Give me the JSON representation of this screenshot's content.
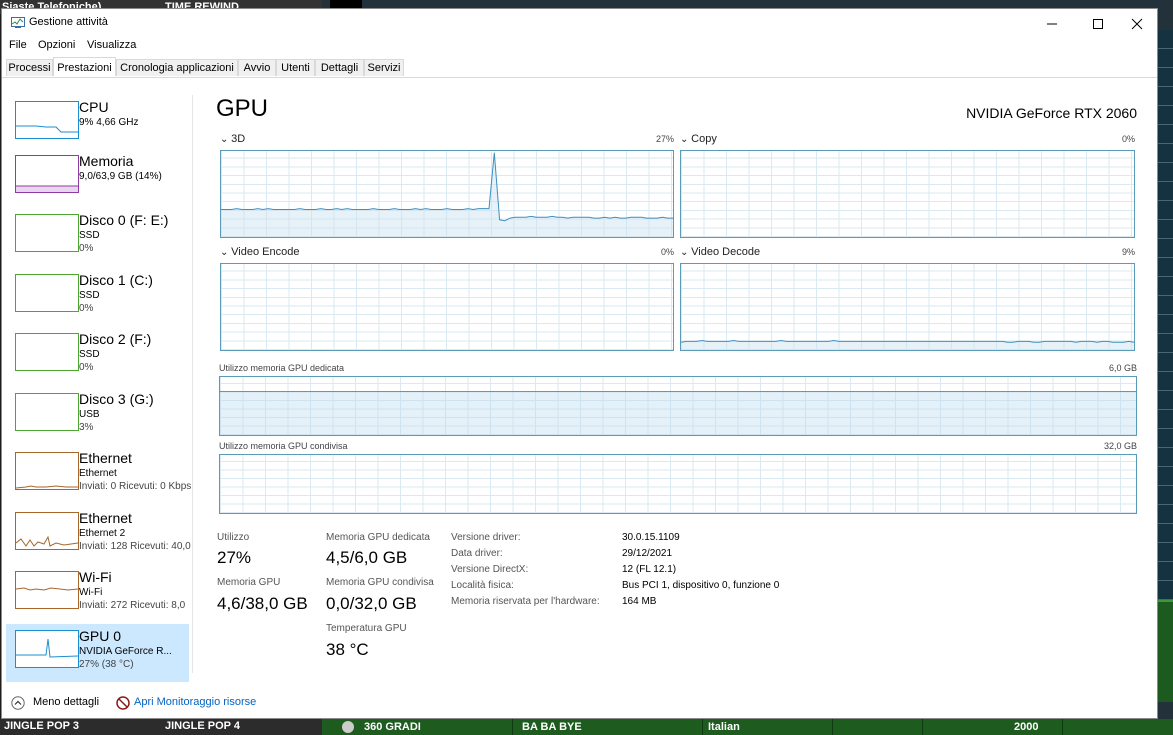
{
  "background": {
    "left_top_text": "Siaste Telefoniche)",
    "left_top_text2": "TIME REWIND",
    "left_bottom_text1": "JINGLE POP 3",
    "left_bottom_text2": "JINGLE POP 4",
    "bottom_row": {
      "title": "360 GRADI",
      "artist": "BA BA BYE",
      "lang": "Italian",
      "year": "2000"
    }
  },
  "window": {
    "title": "Gestione attività",
    "menu": [
      "File",
      "Opzioni",
      "Visualizza"
    ],
    "tabs": [
      "Processi",
      "Prestazioni",
      "Cronologia applicazioni",
      "Avvio",
      "Utenti",
      "Dettagli",
      "Servizi"
    ],
    "active_tab": "Prestazioni"
  },
  "sidebar": {
    "items": [
      {
        "name": "CPU",
        "line2": "9%  4,66 GHz",
        "line3": "",
        "color": "#1a8fcf"
      },
      {
        "name": "Memoria",
        "line2": "9,0/63,9 GB (14%)",
        "line3": "",
        "color": "#8e3ca3"
      },
      {
        "name": "Disco 0 (F: E:)",
        "line2": "SSD",
        "line3": "0%",
        "color": "#4da630"
      },
      {
        "name": "Disco 1 (C:)",
        "line2": "SSD",
        "line3": "0%",
        "color": "#4da630"
      },
      {
        "name": "Disco 2 (F:)",
        "line2": "SSD",
        "line3": "0%",
        "color": "#4da630"
      },
      {
        "name": "Disco 3 (G:)",
        "line2": "USB",
        "line3": "3%",
        "color": "#4da630"
      },
      {
        "name": "Ethernet",
        "line2": "Ethernet",
        "line3": "Inviati: 0 Ricevuti: 0 Kbps",
        "color": "#a7662a"
      },
      {
        "name": "Ethernet",
        "line2": "Ethernet 2",
        "line3": "Inviati: 128 Ricevuti: 40,0",
        "color": "#a7662a"
      },
      {
        "name": "Wi-Fi",
        "line2": "Wi-Fi",
        "line3": "Inviati: 272 Ricevuti: 8,0",
        "color": "#a7662a"
      },
      {
        "name": "GPU 0",
        "line2": "NVIDIA GeForce R...",
        "line3": "27%  (38 °C)",
        "color": "#1a8fcf"
      }
    ]
  },
  "main": {
    "title": "GPU",
    "model": "NVIDIA GeForce RTX 2060",
    "engines": [
      {
        "label": "3D",
        "pct": "27%",
        "series": [
          32,
          32,
          32,
          33,
          32,
          32,
          32,
          33,
          32,
          33,
          32,
          32,
          32,
          32,
          32,
          33,
          32,
          32,
          32,
          33,
          32,
          32,
          33,
          32,
          33,
          32,
          32,
          32,
          32,
          33,
          32,
          32,
          32,
          33,
          32,
          32,
          32,
          33,
          32,
          33,
          32,
          32,
          32,
          33,
          32,
          32,
          32,
          33,
          32,
          33,
          33,
          33,
          98,
          20,
          19,
          22,
          23,
          23,
          23,
          24,
          23,
          23,
          23,
          24,
          23,
          23,
          22,
          23,
          23,
          23,
          23,
          22,
          22,
          23,
          22,
          23,
          22,
          22,
          23,
          23,
          23,
          22,
          22,
          22,
          23,
          22,
          22
        ]
      },
      {
        "label": "Copy",
        "pct": "0%",
        "series": []
      },
      {
        "label": "Video Encode",
        "pct": "0%",
        "series": []
      },
      {
        "label": "Video Decode",
        "pct": "9%",
        "series": [
          9,
          10,
          10,
          10,
          11,
          10,
          10,
          10,
          10,
          10,
          11,
          10,
          10,
          10,
          10,
          10,
          10,
          10,
          10,
          11,
          10,
          10,
          10,
          10,
          10,
          10,
          10,
          10,
          10,
          11,
          10,
          10,
          10,
          10,
          10,
          10,
          10,
          10,
          10,
          10,
          10,
          10,
          10,
          10,
          10,
          10,
          10,
          10,
          10,
          10,
          10,
          10,
          10,
          10,
          10,
          10,
          10,
          10,
          10,
          10,
          10,
          10,
          9,
          9,
          10,
          10,
          10,
          9,
          9,
          10,
          10,
          10,
          10,
          10,
          10,
          9,
          10,
          10,
          10,
          9,
          10,
          10,
          9,
          9,
          9,
          10,
          9
        ]
      }
    ],
    "dedicated_label": "Utilizzo memoria GPU dedicata",
    "dedicated_max": "6,0 GB",
    "dedicated_fraction": 0.75,
    "shared_label": "Utilizzo memoria GPU condivisa",
    "shared_max": "32,0 GB",
    "stats": {
      "utilizzo_label": "Utilizzo",
      "utilizzo": "27%",
      "mem_gpu_label": "Memoria GPU",
      "mem_gpu": "4,6/38,0 GB",
      "dedicata_label": "Memoria GPU dedicata",
      "dedicata": "4,5/6,0 GB",
      "condivisa_label": "Memoria GPU condivisa",
      "condivisa": "0,0/32,0 GB",
      "temp_label": "Temperatura GPU",
      "temp": "38 °C"
    },
    "details": [
      {
        "label": "Versione driver:",
        "value": "30.0.15.1109"
      },
      {
        "label": "Data driver:",
        "value": "29/12/2021"
      },
      {
        "label": "Versione DirectX:",
        "value": "12 (FL 12.1)"
      },
      {
        "label": "Località fisica:",
        "value": "Bus PCI 1, dispositivo 0, funzione 0"
      },
      {
        "label": "Memoria riservata per l'hardware:",
        "value": "164 MB"
      }
    ]
  },
  "footer": {
    "less_details": "Meno dettagli",
    "resource_monitor": "Apri Monitoraggio risorse"
  }
}
